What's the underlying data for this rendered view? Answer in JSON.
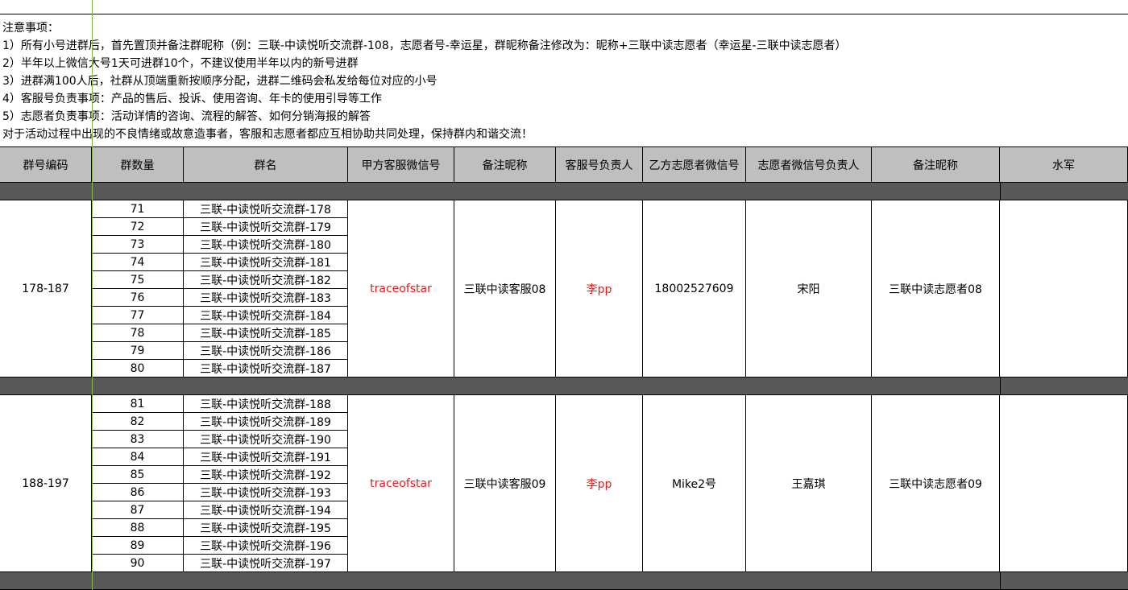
{
  "notes": [
    "注意事项：",
    "1）所有小号进群后，首先置顶并备注群昵称（例：三联-中读悦听交流群-108，志愿者号-幸运星，群昵称备注修改为：昵称+三联中读志愿者（幸运星-三联中读志愿者）",
    "2）半年以上微信大号1天可进群10个，不建议使用半年以内的新号进群",
    "3）进群满100人后，社群从顶端重新按顺序分配，进群二维码会私发给每位对应的小号",
    "4）客服号负责事项：产品的售后、投诉、使用咨询、年卡的使用引导等工作",
    "5）志愿者负责事项：活动详情的咨询、流程的解答、如何分销海报的解答",
    "对于活动过程中出现的不良情绪或故意造事者，客服和志愿者都应互相协助共同处理，保持群内和谐交流！"
  ],
  "headers": [
    "群号编码",
    "群数量",
    "群名",
    "甲方客服微信号",
    "备注昵称",
    "客服号负责人",
    "乙方志愿者微信号",
    "志愿者微信号负责人",
    "备注昵称",
    "水军"
  ],
  "blocks": [
    {
      "code": "178-187",
      "rows": [
        {
          "count": "71",
          "name": "三联-中读悦听交流群-178"
        },
        {
          "count": "72",
          "name": "三联-中读悦听交流群-179"
        },
        {
          "count": "73",
          "name": "三联-中读悦听交流群-180"
        },
        {
          "count": "74",
          "name": "三联-中读悦听交流群-181"
        },
        {
          "count": "75",
          "name": "三联-中读悦听交流群-182"
        },
        {
          "count": "76",
          "name": "三联-中读悦听交流群-183"
        },
        {
          "count": "77",
          "name": "三联-中读悦听交流群-184"
        },
        {
          "count": "78",
          "name": "三联-中读悦听交流群-185"
        },
        {
          "count": "79",
          "name": "三联-中读悦听交流群-186"
        },
        {
          "count": "80",
          "name": "三联-中读悦听交流群-187"
        }
      ],
      "service_wechat": "traceofstar",
      "service_nickname": "三联中读客服08",
      "service_owner": "李pp",
      "volunteer_wechat": "18002527609",
      "volunteer_owner": "宋阳",
      "volunteer_nickname": "三联中读志愿者08",
      "water_army": ""
    },
    {
      "code": "188-197",
      "rows": [
        {
          "count": "81",
          "name": "三联-中读悦听交流群-188"
        },
        {
          "count": "82",
          "name": "三联-中读悦听交流群-189"
        },
        {
          "count": "83",
          "name": "三联-中读悦听交流群-190"
        },
        {
          "count": "84",
          "name": "三联-中读悦听交流群-191"
        },
        {
          "count": "85",
          "name": "三联-中读悦听交流群-192"
        },
        {
          "count": "86",
          "name": "三联-中读悦听交流群-193"
        },
        {
          "count": "87",
          "name": "三联-中读悦听交流群-194"
        },
        {
          "count": "88",
          "name": "三联-中读悦听交流群-195"
        },
        {
          "count": "89",
          "name": "三联-中读悦听交流群-196"
        },
        {
          "count": "90",
          "name": "三联-中读悦听交流群-197"
        }
      ],
      "service_wechat": "traceofstar",
      "service_nickname": "三联中读客服09",
      "service_owner": "李pp",
      "volunteer_wechat": "Mike2号",
      "volunteer_owner": "王嘉琪",
      "volunteer_nickname": "三联中读志愿者09",
      "water_army": ""
    }
  ],
  "colors": {
    "header_bg": "#bfbfbf",
    "separator_bg": "#595959",
    "highlight_text": "#e02020",
    "column_guide": "#7fb74a"
  }
}
